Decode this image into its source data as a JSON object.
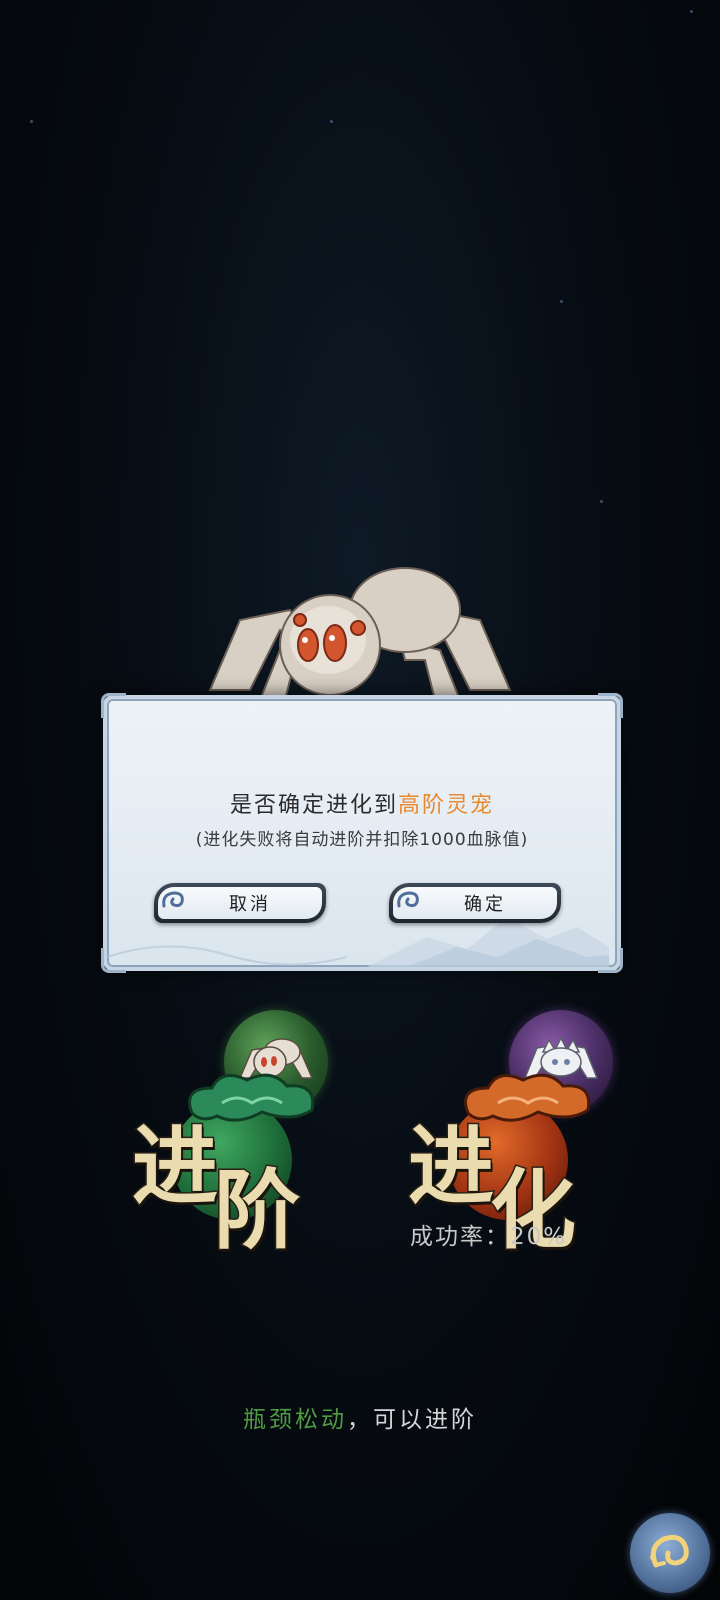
{
  "dialog": {
    "title_prefix": "是否确定进化到",
    "title_highlight": "高阶灵宠",
    "subtitle": "(进化失败将自动进阶并扣除1000血脉值)",
    "cancel_label": "取消",
    "confirm_label": "确定"
  },
  "options": {
    "advance": {
      "char1": "进",
      "char2": "阶"
    },
    "evolve": {
      "char1": "进",
      "char2": "化",
      "success_rate_label": "成功率：20%"
    }
  },
  "status": {
    "highlight": "瓶颈松动",
    "rest": "，可以进阶"
  },
  "colors": {
    "highlight_orange": "#e8892e",
    "highlight_green": "#4f9a43"
  },
  "icons": {
    "corner_button": "swirl-return-icon",
    "button_swirl": "cloud-swirl-icon"
  }
}
